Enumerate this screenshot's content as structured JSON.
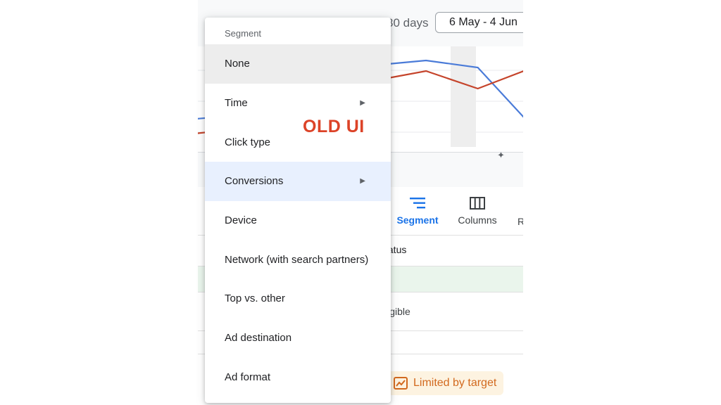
{
  "header": {
    "days_text": "30 days",
    "date_range": "6 May - 4 Jun"
  },
  "chart_data": {
    "type": "line",
    "series": [
      {
        "values": [
          0.36,
          0.44,
          0.54,
          0.9,
          1.15,
          1.2,
          1.1,
          0.25
        ]
      },
      {
        "values": [
          0.15,
          0.25,
          0.2,
          0.8,
          0.95,
          1.05,
          0.8,
          1.1
        ]
      }
    ],
    "colors": [
      "#4a7bd8",
      "#c5442b"
    ],
    "xlabel": "",
    "ylabel": ""
  },
  "toolbar": {
    "segment_label": "Segment",
    "columns_label": "Columns",
    "more_label": "R"
  },
  "table": {
    "status_header": "tatus",
    "row2_status": "ligible",
    "limited_badge": "Limited by target"
  },
  "menu": {
    "header": "Segment",
    "items": [
      {
        "label": "None"
      },
      {
        "label": "Time",
        "submenu": true
      },
      {
        "label": "Click type"
      },
      {
        "label": "Conversions",
        "submenu": true
      },
      {
        "label": "Device"
      },
      {
        "label": "Network (with search partners)"
      },
      {
        "label": "Top vs. other"
      },
      {
        "label": "Ad destination"
      },
      {
        "label": "Ad format"
      }
    ]
  },
  "annotation": {
    "text": "OLD UI",
    "color": "#dc4328"
  }
}
